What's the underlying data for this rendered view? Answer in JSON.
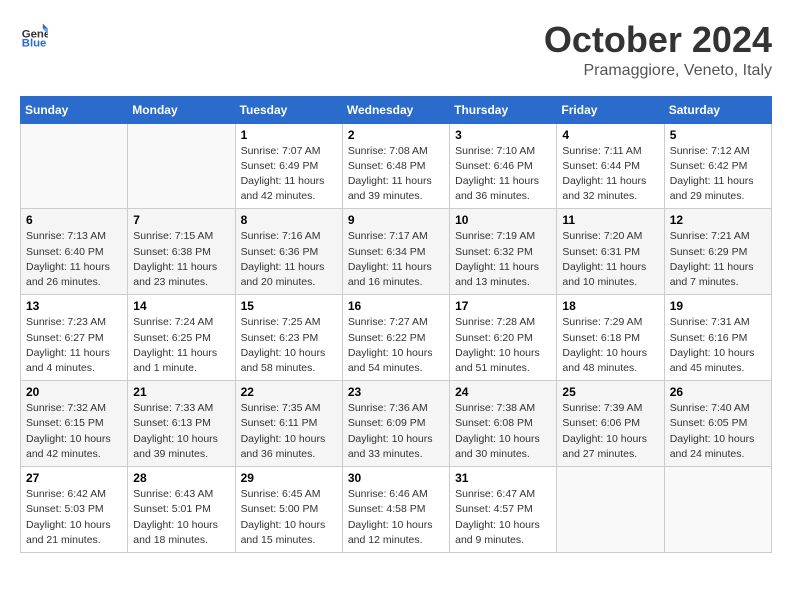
{
  "logo": {
    "text_general": "General",
    "text_blue": "Blue"
  },
  "header": {
    "month": "October 2024",
    "location": "Pramaggiore, Veneto, Italy"
  },
  "days_of_week": [
    "Sunday",
    "Monday",
    "Tuesday",
    "Wednesday",
    "Thursday",
    "Friday",
    "Saturday"
  ],
  "weeks": [
    [
      {
        "day": "",
        "detail": ""
      },
      {
        "day": "",
        "detail": ""
      },
      {
        "day": "1",
        "detail": "Sunrise: 7:07 AM\nSunset: 6:49 PM\nDaylight: 11 hours and 42 minutes."
      },
      {
        "day": "2",
        "detail": "Sunrise: 7:08 AM\nSunset: 6:48 PM\nDaylight: 11 hours and 39 minutes."
      },
      {
        "day": "3",
        "detail": "Sunrise: 7:10 AM\nSunset: 6:46 PM\nDaylight: 11 hours and 36 minutes."
      },
      {
        "day": "4",
        "detail": "Sunrise: 7:11 AM\nSunset: 6:44 PM\nDaylight: 11 hours and 32 minutes."
      },
      {
        "day": "5",
        "detail": "Sunrise: 7:12 AM\nSunset: 6:42 PM\nDaylight: 11 hours and 29 minutes."
      }
    ],
    [
      {
        "day": "6",
        "detail": "Sunrise: 7:13 AM\nSunset: 6:40 PM\nDaylight: 11 hours and 26 minutes."
      },
      {
        "day": "7",
        "detail": "Sunrise: 7:15 AM\nSunset: 6:38 PM\nDaylight: 11 hours and 23 minutes."
      },
      {
        "day": "8",
        "detail": "Sunrise: 7:16 AM\nSunset: 6:36 PM\nDaylight: 11 hours and 20 minutes."
      },
      {
        "day": "9",
        "detail": "Sunrise: 7:17 AM\nSunset: 6:34 PM\nDaylight: 11 hours and 16 minutes."
      },
      {
        "day": "10",
        "detail": "Sunrise: 7:19 AM\nSunset: 6:32 PM\nDaylight: 11 hours and 13 minutes."
      },
      {
        "day": "11",
        "detail": "Sunrise: 7:20 AM\nSunset: 6:31 PM\nDaylight: 11 hours and 10 minutes."
      },
      {
        "day": "12",
        "detail": "Sunrise: 7:21 AM\nSunset: 6:29 PM\nDaylight: 11 hours and 7 minutes."
      }
    ],
    [
      {
        "day": "13",
        "detail": "Sunrise: 7:23 AM\nSunset: 6:27 PM\nDaylight: 11 hours and 4 minutes."
      },
      {
        "day": "14",
        "detail": "Sunrise: 7:24 AM\nSunset: 6:25 PM\nDaylight: 11 hours and 1 minute."
      },
      {
        "day": "15",
        "detail": "Sunrise: 7:25 AM\nSunset: 6:23 PM\nDaylight: 10 hours and 58 minutes."
      },
      {
        "day": "16",
        "detail": "Sunrise: 7:27 AM\nSunset: 6:22 PM\nDaylight: 10 hours and 54 minutes."
      },
      {
        "day": "17",
        "detail": "Sunrise: 7:28 AM\nSunset: 6:20 PM\nDaylight: 10 hours and 51 minutes."
      },
      {
        "day": "18",
        "detail": "Sunrise: 7:29 AM\nSunset: 6:18 PM\nDaylight: 10 hours and 48 minutes."
      },
      {
        "day": "19",
        "detail": "Sunrise: 7:31 AM\nSunset: 6:16 PM\nDaylight: 10 hours and 45 minutes."
      }
    ],
    [
      {
        "day": "20",
        "detail": "Sunrise: 7:32 AM\nSunset: 6:15 PM\nDaylight: 10 hours and 42 minutes."
      },
      {
        "day": "21",
        "detail": "Sunrise: 7:33 AM\nSunset: 6:13 PM\nDaylight: 10 hours and 39 minutes."
      },
      {
        "day": "22",
        "detail": "Sunrise: 7:35 AM\nSunset: 6:11 PM\nDaylight: 10 hours and 36 minutes."
      },
      {
        "day": "23",
        "detail": "Sunrise: 7:36 AM\nSunset: 6:09 PM\nDaylight: 10 hours and 33 minutes."
      },
      {
        "day": "24",
        "detail": "Sunrise: 7:38 AM\nSunset: 6:08 PM\nDaylight: 10 hours and 30 minutes."
      },
      {
        "day": "25",
        "detail": "Sunrise: 7:39 AM\nSunset: 6:06 PM\nDaylight: 10 hours and 27 minutes."
      },
      {
        "day": "26",
        "detail": "Sunrise: 7:40 AM\nSunset: 6:05 PM\nDaylight: 10 hours and 24 minutes."
      }
    ],
    [
      {
        "day": "27",
        "detail": "Sunrise: 6:42 AM\nSunset: 5:03 PM\nDaylight: 10 hours and 21 minutes."
      },
      {
        "day": "28",
        "detail": "Sunrise: 6:43 AM\nSunset: 5:01 PM\nDaylight: 10 hours and 18 minutes."
      },
      {
        "day": "29",
        "detail": "Sunrise: 6:45 AM\nSunset: 5:00 PM\nDaylight: 10 hours and 15 minutes."
      },
      {
        "day": "30",
        "detail": "Sunrise: 6:46 AM\nSunset: 4:58 PM\nDaylight: 10 hours and 12 minutes."
      },
      {
        "day": "31",
        "detail": "Sunrise: 6:47 AM\nSunset: 4:57 PM\nDaylight: 10 hours and 9 minutes."
      },
      {
        "day": "",
        "detail": ""
      },
      {
        "day": "",
        "detail": ""
      }
    ]
  ]
}
